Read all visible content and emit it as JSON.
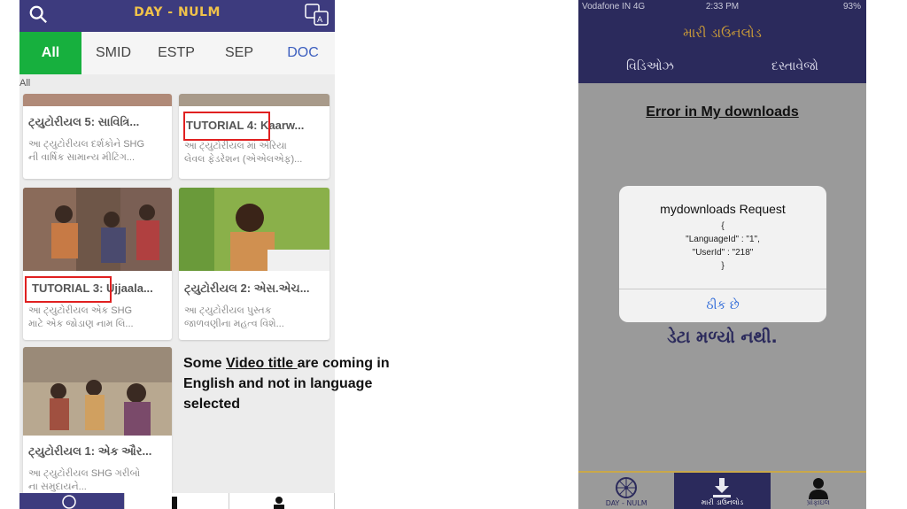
{
  "left_app": {
    "title": "DAY - NULM",
    "tabs": [
      "All",
      "SMID",
      "ESTP",
      "SEP",
      "DOC"
    ],
    "active_tab": "All",
    "section_label": "All",
    "cards": [
      {
        "title": "ટ્યુટોરીયલ 5: સાવિત્રિ...",
        "desc1": "આ ટ્યુટોરીયલ દર્શકોને SHG",
        "desc2": "ની વાર્ષિક સામાન્ય મીટિંગ..."
      },
      {
        "title": "TUTORIAL 4: Kaarw...",
        "desc1": "આ ટ્યુટોરીયલ માં એરિયા",
        "desc2": "લેવલ ફેડરેશન (એએલએફ)..."
      },
      {
        "title": "TUTORIAL 3: Ujjaala...",
        "desc1": "આ ટ્યુટોરીયલ એક SHG",
        "desc2": "માટે એક જોડાણ નામ લિ..."
      },
      {
        "title": "ટ્યુટોરીયલ 2: એસ.એચ...",
        "desc1": "આ ટ્યુટોરીયલ પુસ્તક",
        "desc2": "જાળવણીના મહત્વ વિશે..."
      },
      {
        "title": "ટ્યુટોરીયલ 1: એક ઔર...",
        "desc1": "આ ટ્યુટોરીયલ SHG ગરીબો",
        "desc2": "ના સમુદાયને..."
      }
    ]
  },
  "annotation": {
    "pre": "Some ",
    "underlined": "Video title ",
    "post": "are coming in English and not in language selected"
  },
  "right_app": {
    "status": {
      "carrier": "Vodafone IN  4G",
      "time": "2:33 PM",
      "battery": "93%"
    },
    "title": "મારી ડાઉનલોડ",
    "tabs": [
      "વિડિઓઝ",
      "દસ્તાવેજો"
    ],
    "error_text": "Error in My downloads ",
    "no_data": "ડેટા મળ્યો નથી.",
    "dialog": {
      "title": "mydownloads Request",
      "lines": [
        "{",
        "\"LanguageId\" : \"1\",",
        "\"UserId\" : \"218\"",
        "}"
      ],
      "button": "ઠીક છે"
    },
    "nav": [
      {
        "label": "DAY - NULM",
        "icon": "ashoka-chakra-icon"
      },
      {
        "label": "મારી ડાઉનલોડ",
        "icon": "download-icon"
      },
      {
        "label": "પ્રોફાઇલ",
        "icon": "profile-icon"
      }
    ],
    "active_nav": "મારી ડાઉનલોડ"
  },
  "colors": {
    "header": "#3d3b7e",
    "active_tab": "#17b03e",
    "highlight": "#e02020",
    "right_header": "#2b2a5c",
    "gold": "#c9a84a",
    "dialog_button": "#2f6ad8"
  }
}
